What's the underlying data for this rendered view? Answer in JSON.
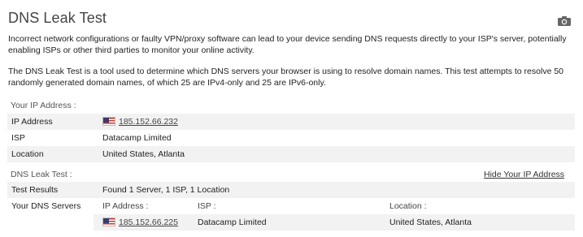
{
  "page": {
    "title": "DNS Leak Test",
    "camera_icon": "camera-icon",
    "intro_1": "Incorrect network configurations or faulty VPN/proxy software can lead to your device sending DNS requests directly to your ISP's server, potentially enabling ISPs or other third parties to monitor your online activity.",
    "intro_2": "The DNS Leak Test is a tool used to determine which DNS servers your browser is using to resolve domain names. This test attempts to resolve 50 randomly generated domain names, of which 25 are IPv4-only and 25 are IPv6-only."
  },
  "ip_section": {
    "heading": "Your IP Address :",
    "rows": [
      {
        "label": "IP Address",
        "value": "185.152.66.232",
        "flag": "us-flag-icon"
      },
      {
        "label": "ISP",
        "value": "Datacamp Limited"
      },
      {
        "label": "Location",
        "value": "United States, Atlanta"
      }
    ]
  },
  "dns_section": {
    "heading": "DNS Leak Test :",
    "hide_link": "Hide Your IP Address",
    "test_results_label": "Test Results",
    "test_results_value": "Found 1 Server, 1 ISP, 1 Location",
    "servers_label": "Your DNS Servers",
    "columns": {
      "ip": "IP Address :",
      "isp": "ISP :",
      "location": "Location :"
    },
    "servers": [
      {
        "ip": "185.152.66.225",
        "isp": "Datacamp Limited",
        "location": "United States, Atlanta",
        "flag": "us-flag-icon"
      }
    ]
  },
  "colors": {
    "row_shade": "#f2f2f2",
    "flag_red": "#c0392b",
    "flag_blue": "#3c3b6e"
  }
}
